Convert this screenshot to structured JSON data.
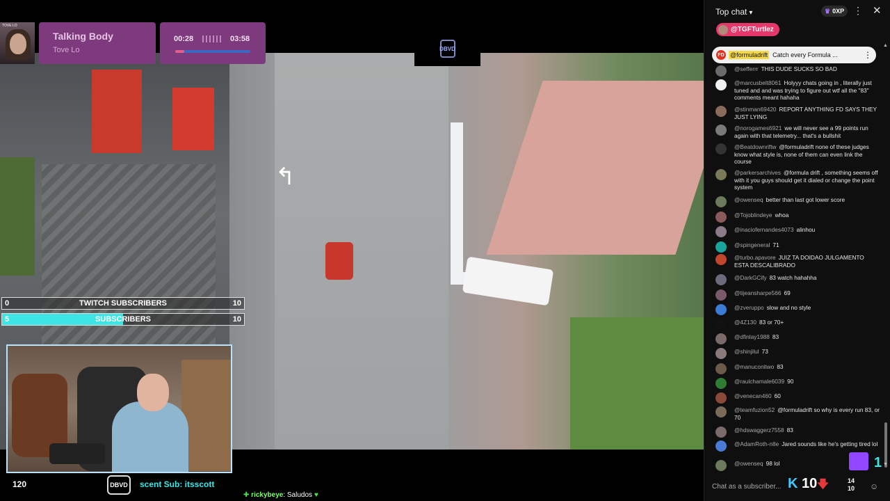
{
  "now_playing": {
    "song": "Talking Body",
    "artist": "Tove Lo",
    "album_caption": "TOVE LO",
    "elapsed": "00:28",
    "duration": "03:58",
    "progress": 0.12
  },
  "video": {
    "logo_text": "DBVD"
  },
  "goals": [
    {
      "low": "0",
      "label": "TWITCH SUBSCRIBERS",
      "high": "10",
      "progress": 0
    },
    {
      "low": "5",
      "label": "SUBSCRIBERS",
      "high": "10",
      "progress": 0.5
    }
  ],
  "overlay": {
    "bottom_left_number": "120",
    "logo_text": "DBVD",
    "recent_sub": "scent Sub: itsscott",
    "bottom_chat_user": "rickybeye",
    "bottom_chat_text": ": Saludos"
  },
  "chat": {
    "header_title": "Top chat",
    "xp": "0XP",
    "pinned_user": "@TGFTurtlez",
    "banner_channel": "@formuladrift",
    "banner_text": "Catch every Formula ...",
    "input_placeholder": "Chat as a subscriber...",
    "k_count": "10",
    "stats_top": "14",
    "stats_bottom": "10",
    "messages": [
      {
        "user": "@sefferrr",
        "text": "THIS DUDE SUCKS SO BAD",
        "color": "#6a6a6a"
      },
      {
        "user": "@marcusbelt8061",
        "text": "Holyyy chats going in , literally just tuned and and was trying to figure out wtf all the \"83\" comments meant hahaha",
        "color": "#f0f0f0"
      },
      {
        "user": "@stinman69420",
        "text": "REPORT ANYTHING FD SAYS THEY JUST LYING",
        "color": "#8a6a5a"
      },
      {
        "user": "@norogames6921",
        "text": "we will never see a 99 points run again with that telemetry... that's a bullshit",
        "color": "#7a7a7a"
      },
      {
        "user": "@Beatdownriftw",
        "text": "@formuladrift none of these judges know what style is, none of them can even link the course",
        "color": "#333333"
      },
      {
        "user": "@parkersarchives",
        "text": "@formula drift , something seems off with it you guys should get it dialed or change the point system",
        "color": "#7a7a5a"
      },
      {
        "user": "@owenseq",
        "text": "better than last got lower score",
        "color": "#6a7a5a"
      },
      {
        "user": "@Tojoblindeye",
        "text": "whoa",
        "color": "#8a5a5a"
      },
      {
        "user": "@inaciofernandes4073",
        "text": "alinhou",
        "color": "#8a7a8a"
      },
      {
        "user": "@spingeneral",
        "text": "71",
        "color": "#1aa39a"
      },
      {
        "user": "@turbo.apavore",
        "text": "JUIZ TA DOIDAO JULGAMENTO ESTA DESCALIBRADO",
        "color": "#c0462e"
      },
      {
        "user": "@DarkGCify",
        "text": "83 watch hahahha",
        "color": "#6a6a7a"
      },
      {
        "user": "@tijeansharpe566",
        "text": "69",
        "color": "#7a5a6a"
      },
      {
        "user": "@zveruppo",
        "text": "slow and no style",
        "color": "#3a7bd5"
      },
      {
        "user": "@4Z130",
        "text": "83 or 70+",
        "color": "#111111"
      },
      {
        "user": "@dfinlay1988",
        "text": "83",
        "color": "#7a6a6a"
      },
      {
        "user": "@shinjilul",
        "text": "73",
        "color": "#8a7a7a"
      },
      {
        "user": "@manuconitwo",
        "text": "83",
        "color": "#6a5a4a"
      },
      {
        "user": "@raulchamale6039",
        "text": "90",
        "color": "#2e7d32"
      },
      {
        "user": "@venecan460",
        "text": "60",
        "color": "#8a4a3a"
      },
      {
        "user": "@teamfuzion52",
        "text": "@formuladrift so why is every run 83, or 70",
        "color": "#7a6a5a"
      },
      {
        "user": "@hdswaggerz7558",
        "text": "83",
        "color": "#7a6a6a"
      },
      {
        "user": "@AdamRoth-n8e",
        "text": "Jared sounds like he's getting tired lol",
        "color": "#4a7bd5"
      },
      {
        "user": "@owenseq",
        "text": "98 lol",
        "color": "#6a7a5a"
      }
    ]
  }
}
